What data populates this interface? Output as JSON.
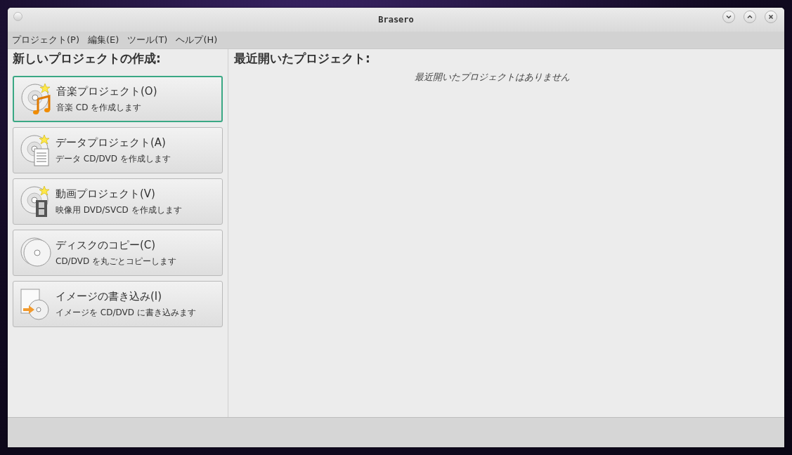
{
  "window": {
    "title": "Brasero"
  },
  "menu": [
    "プロジェクト(P)",
    "編集(E)",
    "ツール(T)",
    "ヘルプ(H)"
  ],
  "new_project": {
    "heading": "新しいプロジェクトの作成:",
    "items": [
      {
        "kind": "music",
        "title": "音楽プロジェクト(O)",
        "subtitle": "音楽 CD を作成します",
        "selected": true
      },
      {
        "kind": "data",
        "title": "データプロジェクト(A)",
        "subtitle": "データ CD/DVD を作成します",
        "selected": false
      },
      {
        "kind": "video",
        "title": "動画プロジェクト(V)",
        "subtitle": "映像用 DVD/SVCD を作成します",
        "selected": false
      },
      {
        "kind": "copy",
        "title": "ディスクのコピー(C)",
        "subtitle": "CD/DVD を丸ごとコピーします",
        "selected": false
      },
      {
        "kind": "image",
        "title": "イメージの書き込み(I)",
        "subtitle": "イメージを CD/DVD に書き込みます",
        "selected": false
      }
    ]
  },
  "recent": {
    "heading": "最近開いたプロジェクト:",
    "empty_message": "最近開いたプロジェクトはありません"
  }
}
